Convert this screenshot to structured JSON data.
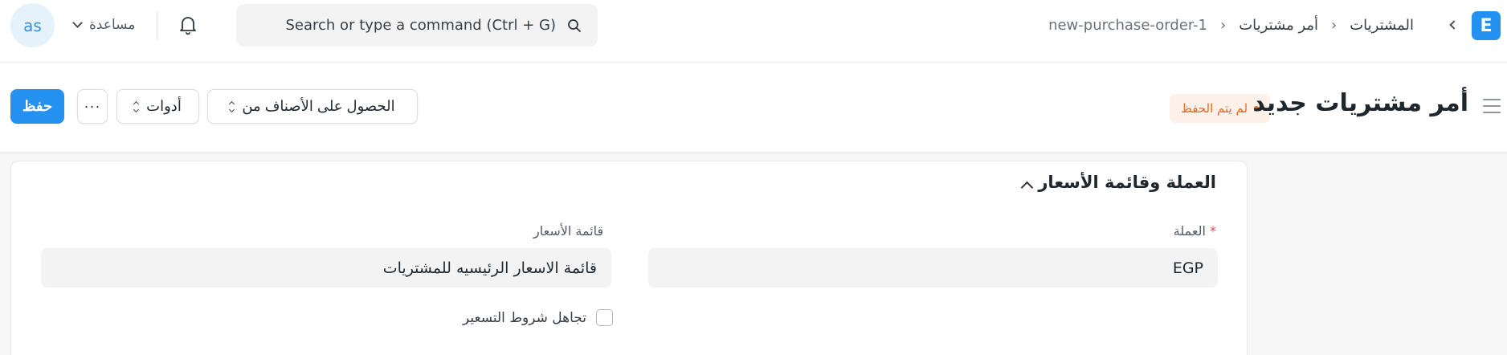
{
  "navbar": {
    "avatar_initials": "as",
    "help_label": "مساعدة",
    "search_placeholder": "Search or type a command (Ctrl + G)",
    "breadcrumbs": [
      "المشتريات",
      "أمر مشتريات",
      "new-purchase-order-1"
    ],
    "logo_letter": "E",
    "logo_color": "#2490ef"
  },
  "page_head": {
    "title": "أمر مشتريات جديد",
    "status": "لم يتم الحفظ",
    "status_color": "#e8681f",
    "get_items_label": "الحصول على الأصناف من",
    "tools_label": "أدوات",
    "more_label": "···",
    "save_label": "حفظ"
  },
  "form": {
    "section_title": "العملة وقائمة الأسعار",
    "currency": {
      "label": "العملة",
      "required_mark": "*",
      "value": "EGP"
    },
    "price_list": {
      "label": "قائمة الأسعار",
      "value": "قائمة الاسعار الرئيسيه للمشتريات"
    },
    "ignore_pricing_rule": {
      "label": "تجاهل شروط التسعير",
      "checked": false
    }
  }
}
